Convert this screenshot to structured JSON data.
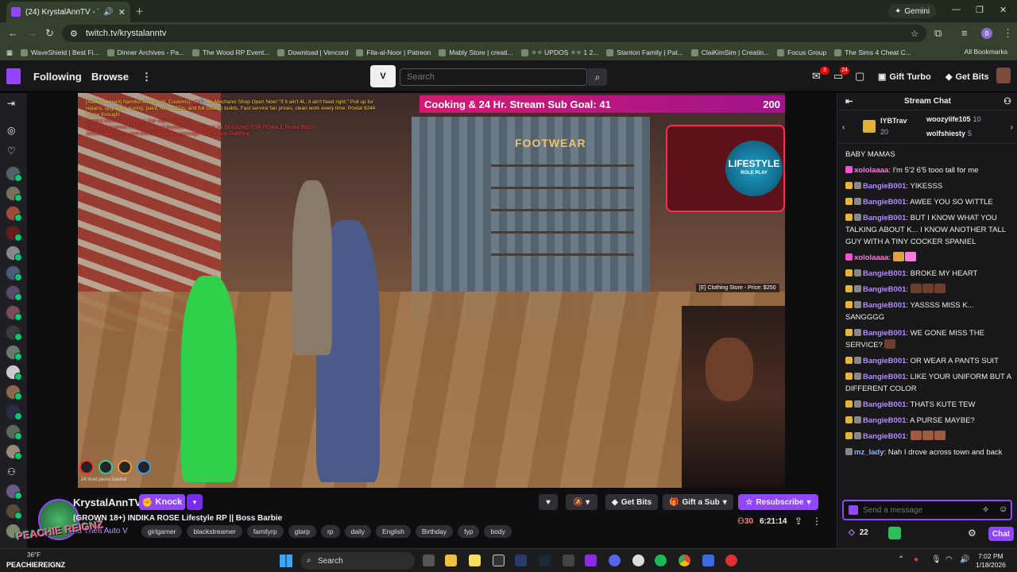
{
  "browser": {
    "tab_title": "(24) KrystalAnnTV - Twitch",
    "url": "twitch.tv/krystalanntv",
    "gemini_label": "Gemini",
    "profile_initial": "B",
    "bookmarks": [
      "WaveShield | Best Fi...",
      "Dinner Archives - Pa...",
      "The Wood RP Event...",
      "Download | Vencord",
      "Fila-al-Noor | Patreon",
      "Mably Store | creati...",
      "✧✧ UPDOS ✧✧ 1 2...",
      "Stanton Family | Pat...",
      "ClaiKimSim | Creatin...",
      "Focus Group",
      "The Sims 4 Cheat C..."
    ],
    "all_bookmarks": "All Bookmarks"
  },
  "twitch_nav": {
    "following": "Following",
    "browse": "Browse",
    "search_placeholder": "Search",
    "notif_count": "3",
    "whisper_count": "24",
    "gift_turbo": "Gift Turbo",
    "get_bits": "Get Bits"
  },
  "stream_overlay": {
    "advert_line1": "[Advertisement] Namiko Amano (4L Customs): 🚗🔧 4L Mechanic Shop Open Now! \"If it ain't 4L, it ain't fixed right.\" Pull up for repairs, upgrades, tuning, paint, rims, LEDs, and full custom builds. Fast service fair prices, clean work every time. Postal 9244 Come through!",
    "advert_line2": "[Latido] Giovanna Holiday: Car wipe 10 sec. ))",
    "advert_line3": "[Latido] Giovanna Holiday: Tactical Baddies is now open! 24 SEASONS FOR FEMALE Postal 9932)",
    "advert_line4": "Jelissa Jeamishon sent Kenzo Soulier a message for Crimson Outfitting",
    "goal_label": "Cooking & 24 Hr. Stream Sub Goal:",
    "goal_current": "41",
    "goal_target": "200",
    "footwear_sign": "FOOTWEAR",
    "lifestyle_logo": "LIFESTYLE",
    "lifestyle_sub": "ROLE PLAY",
    "price_tag": "[E] Clothing Store - Price: $250",
    "mod_packs": "24 mod packs loaded",
    "hud_values": [
      "96%",
      "0%",
      "12%",
      "9%"
    ]
  },
  "channel": {
    "name": "KrystalAnnTV",
    "knock_label": "Knock",
    "title": "(GROWN 18+) INDIKA ROSE Lifestyle RP || Boss Barbie",
    "category": "nd Theft Auto V",
    "tags": [
      "girlgamer",
      "blackstreamer",
      "familyrp",
      "gtarp",
      "rp",
      "daily",
      "English",
      "Birthday",
      "fyp",
      "body"
    ],
    "get_bits": "Get Bits",
    "gift_a_sub": "Gift a Sub",
    "resubscribe": "Resubscribe",
    "viewers": "30",
    "uptime": "6:21:14",
    "overlay_name": "PEACHIE REIGNZ"
  },
  "chat": {
    "header": "Stream Chat",
    "leaderboard": [
      {
        "name": "IYBTrav",
        "count": "20"
      },
      {
        "name": "woozylife105",
        "count": "10"
      },
      {
        "name": "wolfshiesty",
        "count": "5"
      }
    ],
    "messages": [
      {
        "user": "",
        "text": "BABY MAMAS"
      },
      {
        "user": "xololaaaa",
        "text": "I'm 5'2 6'5 tooo tall for me"
      },
      {
        "user": "BangieB001",
        "text": "YIKESSS"
      },
      {
        "user": "BangieB001",
        "text": "AWEE YOU SO WITTLE"
      },
      {
        "user": "BangieB001",
        "text": "BUT I KNOW WHAT YOU TALKING ABOUT K... I KNOW ANOTHER TALL GUY WITH A TINY COCKER SPANIEL"
      },
      {
        "user": "xololaaaa",
        "text": ""
      },
      {
        "user": "BangieB001",
        "text": "BROKE MY HEART"
      },
      {
        "user": "BangieB001",
        "text": ""
      },
      {
        "user": "BangieB001",
        "text": "YASSSS MISS K... SANGGGG"
      },
      {
        "user": "BangieB001",
        "text": "WE GONE MISS THE SERVICE?"
      },
      {
        "user": "BangieB001",
        "text": "OR WEAR A PANTS SUIT"
      },
      {
        "user": "BangieB001",
        "text": "LIKE YOUR UNIFORM BUT A DIFFERENT COLOR"
      },
      {
        "user": "BangieB001",
        "text": "THATS KUTE TEW"
      },
      {
        "user": "BangieB001",
        "text": "A PURSE MAYBE?"
      },
      {
        "user": "BangieB001",
        "text": ""
      },
      {
        "user": "mz_lady",
        "text": "Nah I drove across town and back"
      }
    ],
    "input_placeholder": "Send a message",
    "bits_count": "22",
    "chat_button": "Chat"
  },
  "taskbar": {
    "search": "Search",
    "weather": "36°F",
    "overlay_handle": "PEACHIEREIGNZ",
    "time": "7:02 PM",
    "date": "1/18/2026"
  },
  "colors": {
    "twitch_purple": "#9146ff",
    "goal_pink": "#d01c72",
    "browser_bg": "#35402f"
  }
}
